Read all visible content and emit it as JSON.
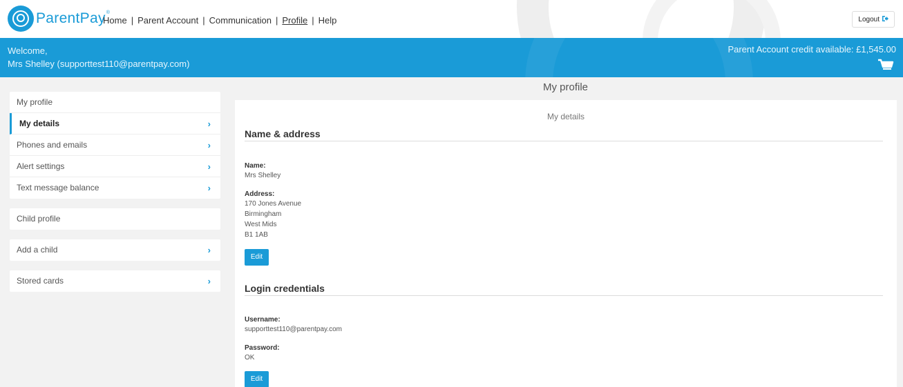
{
  "header": {
    "logo_text": "ParentPay",
    "logo_mark": "®",
    "nav": [
      "Home",
      "Parent Account",
      "Communication",
      "Profile",
      "Help"
    ],
    "logout_label": "Logout"
  },
  "banner": {
    "welcome": "Welcome,",
    "user": "Mrs Shelley (supporttest110@parentpay.com)",
    "credit": "Parent Account credit available: £1,545.00"
  },
  "page_title": "My profile",
  "sidebar": {
    "my_profile_head": "My profile",
    "items": [
      {
        "label": "My details"
      },
      {
        "label": "Phones and emails"
      },
      {
        "label": "Alert settings"
      },
      {
        "label": "Text message balance"
      }
    ],
    "child_profile": "Child profile",
    "add_child": "Add a child",
    "stored_cards": "Stored cards"
  },
  "main": {
    "subtitle": "My details",
    "name_address": {
      "heading": "Name & address",
      "name_label": "Name:",
      "name_value": "Mrs Shelley",
      "address_label": "Address:",
      "address_lines": [
        "170 Jones Avenue",
        "Birmingham",
        "West Mids",
        "B1 1AB"
      ],
      "edit_label": "Edit"
    },
    "login": {
      "heading": "Login credentials",
      "username_label": "Username:",
      "username_value": "supporttest110@parentpay.com",
      "password_label": "Password:",
      "password_value": "OK",
      "edit_label": "Edit"
    }
  },
  "colors": {
    "brand": "#1a9bd7",
    "page_bg": "#f2f2f2"
  },
  "icons": {
    "logout": "logout-icon",
    "cart": "shopping-cart-icon",
    "chevron": "chevron-right-icon"
  }
}
